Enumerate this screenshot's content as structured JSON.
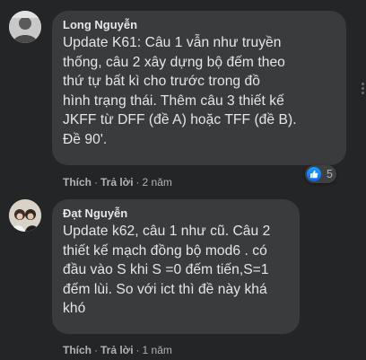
{
  "comments": [
    {
      "author": "Long Nguyễn",
      "text": "Update K61: Câu 1 vẫn như truyền\nthống, câu 2 xây dựng bộ đếm theo\nthứ tự bất kì cho trước trong đồ\nhình trạng thái. Thêm câu 3 thiết kế\nJKFF từ DFF (đề A) hoặc TFF (đề B).\nĐề 90'.",
      "like_label": "Thích",
      "reply_label": "Trả lời",
      "time": "2 năm",
      "reaction": {
        "icon": "like-icon",
        "count": "5",
        "color": "#1877f2"
      }
    },
    {
      "author": "Đạt Nguyễn",
      "text": "Update k62, câu 1 như cũ. Câu 2\nthiết kế mạch đồng bộ mod6 . có\nđầu vào S khi S =0 đếm tiến,S=1\nđếm lùi. So với ict thì đề này khá\nkhó",
      "like_label": "Thích",
      "reply_label": "Trả lời",
      "time": "1 năm"
    }
  ]
}
